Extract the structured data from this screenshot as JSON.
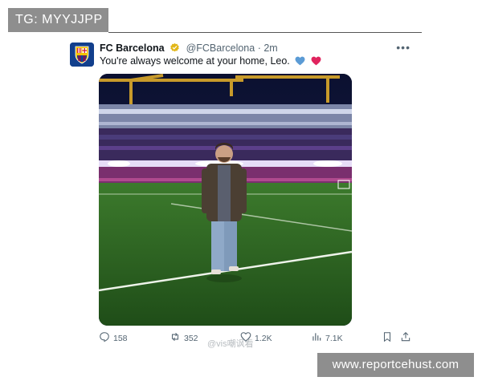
{
  "overlay": {
    "top_label": "TG: MYYJJPP",
    "bottom_label": "www.reportcehust.com",
    "center_watermark": "@vis嘲讽看"
  },
  "post": {
    "account_name": "FC Barcelona",
    "handle": "@FCBarcelona",
    "separator": "·",
    "time": "2m",
    "text": "You're always welcome at your home, Leo.",
    "avatar_icon": "fc-barcelona-crest-icon",
    "verified_icon": "gold-verified-badge-icon",
    "text_emojis": [
      "blue-heart-icon",
      "red-heart-icon"
    ],
    "more_icon": "more-dots-icon",
    "photo": {
      "subject": "man-standing-on-stadium-pitch"
    }
  },
  "actions": {
    "replies": {
      "icon": "reply-icon",
      "count": "158"
    },
    "reposts": {
      "icon": "repost-icon",
      "count": "352"
    },
    "likes": {
      "icon": "like-icon",
      "count": "1.2K"
    },
    "views": {
      "icon": "views-icon",
      "count": "7.1K"
    },
    "bookmark": {
      "icon": "bookmark-icon"
    },
    "share": {
      "icon": "share-icon"
    }
  },
  "colors": {
    "overlay_gray": "#8e8e8e",
    "muted_text": "#536471",
    "verified_gold": "#e2b719",
    "heart_blue": "#5b9bd5",
    "heart_red": "#e0245e",
    "pitch_green": "#2f6b25"
  }
}
